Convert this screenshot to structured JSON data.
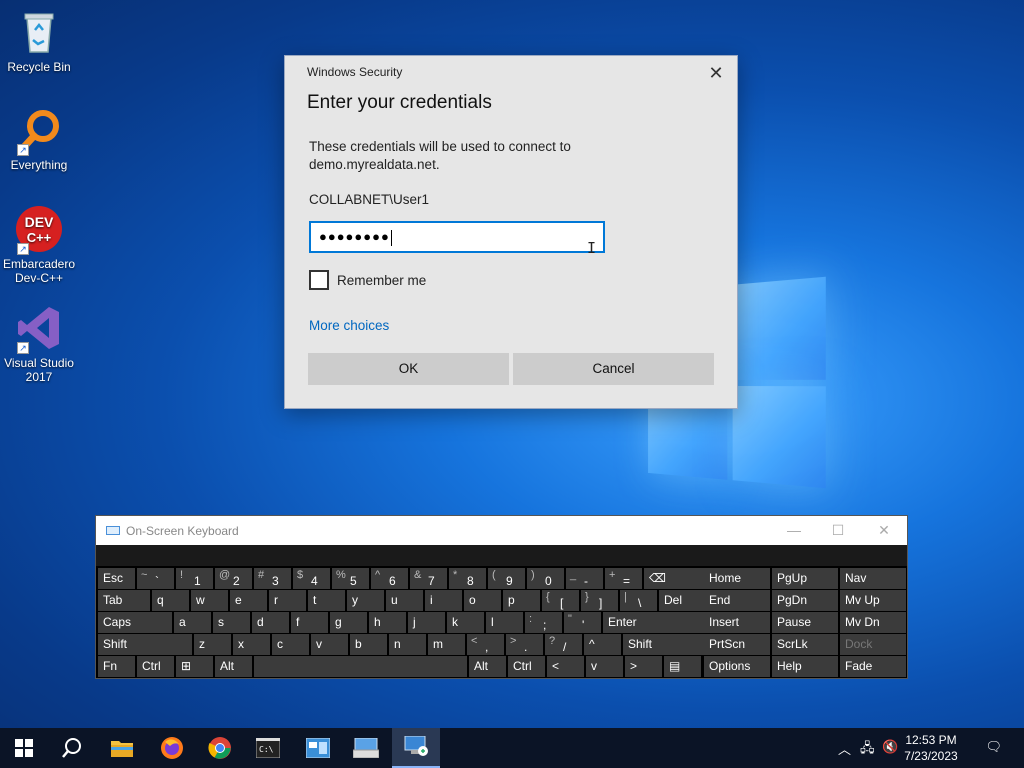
{
  "desktop": {
    "icons": [
      {
        "label": "Recycle Bin"
      },
      {
        "label": "Everything"
      },
      {
        "label": "Embarcadero Dev-C++"
      },
      {
        "label": "Visual Studio 2017"
      }
    ]
  },
  "dialog": {
    "caption": "Windows Security",
    "heading": "Enter your credentials",
    "message": "These credentials will be used to connect to demo.myrealdata.net.",
    "username": "COLLABNET\\User1",
    "password_masked": "●●●●●●●●",
    "remember_label": "Remember me",
    "remember_checked": false,
    "more_choices": "More choices",
    "ok_label": "OK",
    "cancel_label": "Cancel",
    "accent": "#0078d7"
  },
  "osk": {
    "title": "On-Screen Keyboard",
    "rows": [
      [
        {
          "m": "Esc"
        },
        {
          "s": "~",
          "m": "`"
        },
        {
          "s": "!",
          "m": "1"
        },
        {
          "s": "@",
          "m": "2"
        },
        {
          "s": "#",
          "m": "3"
        },
        {
          "s": "$",
          "m": "4"
        },
        {
          "s": "%",
          "m": "5"
        },
        {
          "s": "^",
          "m": "6"
        },
        {
          "s": "&",
          "m": "7"
        },
        {
          "s": "*",
          "m": "8"
        },
        {
          "s": "(",
          "m": "9"
        },
        {
          "s": ")",
          "m": "0"
        },
        {
          "s": "_",
          "m": "-"
        },
        {
          "s": "+",
          "m": "="
        },
        {
          "m": "⌫"
        }
      ],
      [
        {
          "m": "Tab"
        },
        {
          "m": "q"
        },
        {
          "m": "w"
        },
        {
          "m": "e"
        },
        {
          "m": "r"
        },
        {
          "m": "t"
        },
        {
          "m": "y"
        },
        {
          "m": "u"
        },
        {
          "m": "i"
        },
        {
          "m": "o"
        },
        {
          "m": "p"
        },
        {
          "s": "{",
          "m": "["
        },
        {
          "s": "}",
          "m": "]"
        },
        {
          "s": "|",
          "m": "\\"
        },
        {
          "m": "Del"
        }
      ],
      [
        {
          "m": "Caps"
        },
        {
          "m": "a"
        },
        {
          "m": "s"
        },
        {
          "m": "d"
        },
        {
          "m": "f"
        },
        {
          "m": "g"
        },
        {
          "m": "h"
        },
        {
          "m": "j"
        },
        {
          "m": "k"
        },
        {
          "m": "l"
        },
        {
          "s": ":",
          "m": ";"
        },
        {
          "s": "\"",
          "m": "'"
        },
        {
          "m": "Enter"
        }
      ],
      [
        {
          "m": "Shift"
        },
        {
          "m": "z"
        },
        {
          "m": "x"
        },
        {
          "m": "c"
        },
        {
          "m": "v"
        },
        {
          "m": "b"
        },
        {
          "m": "n"
        },
        {
          "m": "m"
        },
        {
          "s": "<",
          "m": ","
        },
        {
          "s": ">",
          "m": "."
        },
        {
          "s": "?",
          "m": "/"
        },
        {
          "m": "^"
        },
        {
          "m": "Shift"
        }
      ],
      [
        {
          "m": "Fn"
        },
        {
          "m": "Ctrl"
        },
        {
          "m": "⊞"
        },
        {
          "m": "Alt"
        },
        {
          "m": ""
        },
        {
          "m": "Alt"
        },
        {
          "m": "Ctrl"
        },
        {
          "m": "<"
        },
        {
          "m": "v"
        },
        {
          "m": ">"
        },
        {
          "m": "▤"
        }
      ]
    ],
    "nav": [
      [
        "Home",
        "PgUp",
        "Nav"
      ],
      [
        "End",
        "PgDn",
        "Mv Up"
      ],
      [
        "Insert",
        "Pause",
        "Mv Dn"
      ],
      [
        "PrtScn",
        "ScrLk",
        "Dock"
      ],
      [
        "Options",
        "Help",
        "Fade"
      ]
    ]
  },
  "taskbar": {
    "time": "12:53 PM",
    "date": "7/23/2023"
  }
}
